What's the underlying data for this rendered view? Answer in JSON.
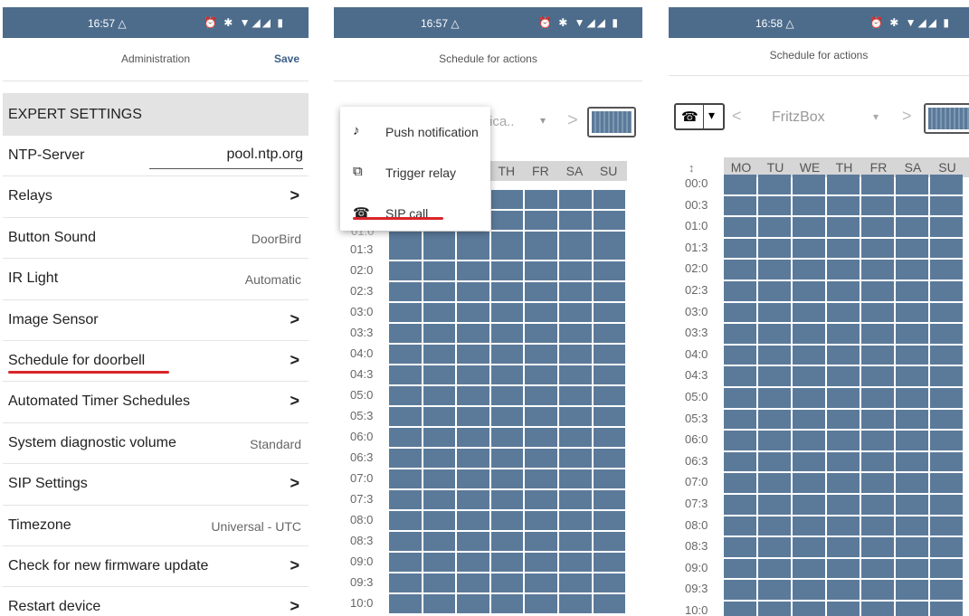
{
  "screen1": {
    "status": {
      "time": "16:57 △",
      "icons": "⏰ ✱ ▼◢◢ ▮"
    },
    "header": {
      "title": "Administration",
      "save_label": "Save"
    },
    "section": "EXPERT SETTINGS",
    "rows": [
      {
        "label": "NTP-Server",
        "value": "pool.ntp.org",
        "kind": "input"
      },
      {
        "label": "Relays",
        "kind": "chevron"
      },
      {
        "label": "Button Sound",
        "value": "DoorBird",
        "kind": "value"
      },
      {
        "label": "IR Light",
        "value": "Automatic",
        "kind": "value"
      },
      {
        "label": "Image Sensor",
        "kind": "chevron"
      },
      {
        "label": "Schedule for doorbell",
        "kind": "chevron"
      },
      {
        "label": "Automated Timer Schedules",
        "kind": "chevron"
      },
      {
        "label": "System diagnostic volume",
        "value": "Standard",
        "kind": "value"
      },
      {
        "label": "SIP Settings",
        "kind": "chevron"
      },
      {
        "label": "Timezone",
        "value": "Universal - UTC",
        "kind": "value"
      },
      {
        "label": "Check for new firmware update",
        "kind": "chevron"
      },
      {
        "label": "Restart device",
        "kind": "chevron"
      }
    ],
    "chevron": ">"
  },
  "screen2": {
    "status": {
      "time": "16:57 △",
      "icons": "⏰ ✱ ▼◢◢ ▮"
    },
    "header": {
      "title": "Schedule for actions"
    },
    "selector_partial": "ica..",
    "menu": [
      {
        "icon": "bell-icon",
        "glyph": "♪",
        "label": "Push notification"
      },
      {
        "icon": "relay-icon",
        "glyph": "⧉",
        "label": "Trigger relay"
      },
      {
        "icon": "phone-icon",
        "glyph": "☎",
        "label": "SIP call"
      }
    ],
    "days_visible": [
      "TH",
      "FR",
      "SA",
      "SU"
    ],
    "times": [
      "01:3",
      "02:0",
      "02:3",
      "03:0",
      "03:3",
      "04:0",
      "04:3",
      "05:0",
      "05:3",
      "06:0",
      "06:3",
      "07:0",
      "07:3",
      "08:0",
      "08:3",
      "09:0",
      "09:3",
      "10:0"
    ],
    "cut_time": "01:0"
  },
  "screen3": {
    "status": {
      "time": "16:58 △",
      "icons": "⏰ ✱ ▼◢◢ ▮"
    },
    "header": {
      "title": "Schedule for actions"
    },
    "action_icon": "☎",
    "caret": "⌵",
    "selector": "FritzBox",
    "prev": "<",
    "next": ">",
    "dropdown_arrow": "▾",
    "sort_icon": "↕",
    "days": [
      "MO",
      "TU",
      "WE",
      "TH",
      "FR",
      "SA",
      "SU"
    ],
    "times": [
      "00:0",
      "00:3",
      "01:0",
      "01:3",
      "02:0",
      "02:3",
      "03:0",
      "03:3",
      "04:0",
      "04:3",
      "05:0",
      "05:3",
      "06:0",
      "06:3",
      "07:0",
      "07:3",
      "08:0",
      "08:3",
      "09:0",
      "09:3",
      "10:0"
    ]
  },
  "colors": {
    "statusbar": "#4d6c8c",
    "cell": "#5b7a9a",
    "accent_red": "#d9252a",
    "save": "#3a5f87"
  }
}
